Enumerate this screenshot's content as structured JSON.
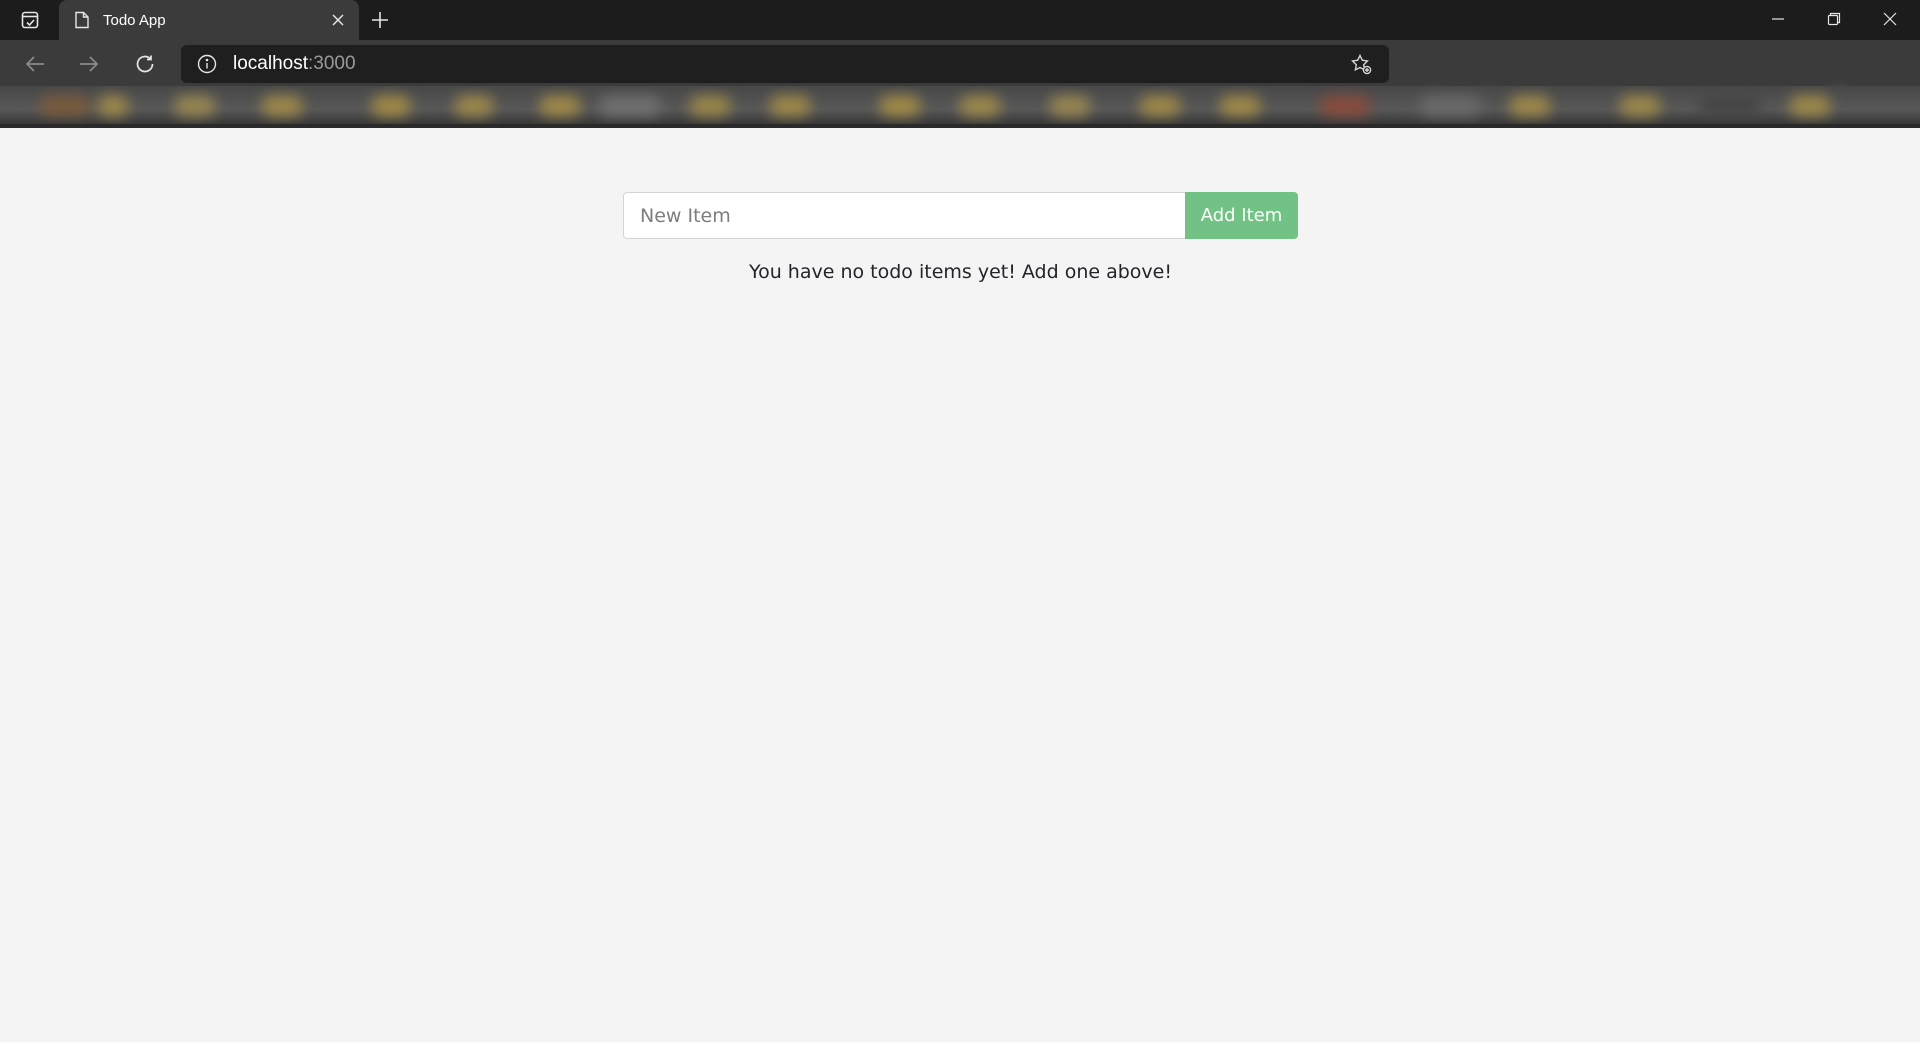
{
  "browser": {
    "tab": {
      "title": "Todo App"
    },
    "omnibox": {
      "host": "localhost",
      "port": ":3000"
    }
  },
  "todo": {
    "input_placeholder": "New Item",
    "input_value": "",
    "add_button_label": "Add Item",
    "empty_message": "You have no todo items yet! Add one above!"
  },
  "colors": {
    "page_background": "#f4f4f4",
    "add_button": "#72c285",
    "chrome_dark": "#1c1c1c",
    "chrome_toolbar": "#3b3b3b"
  },
  "icons": {
    "tab_actions": "tab-actions-icon",
    "tab_favicon": "page-icon",
    "tab_close": "close-icon",
    "new_tab": "plus-icon",
    "back": "arrow-left-icon",
    "forward": "arrow-right-icon",
    "reload": "reload-icon",
    "site_info": "info-icon",
    "favorite": "star-add-icon",
    "minimize": "minimize-icon",
    "maximize": "restore-icon",
    "close_window": "close-icon"
  }
}
